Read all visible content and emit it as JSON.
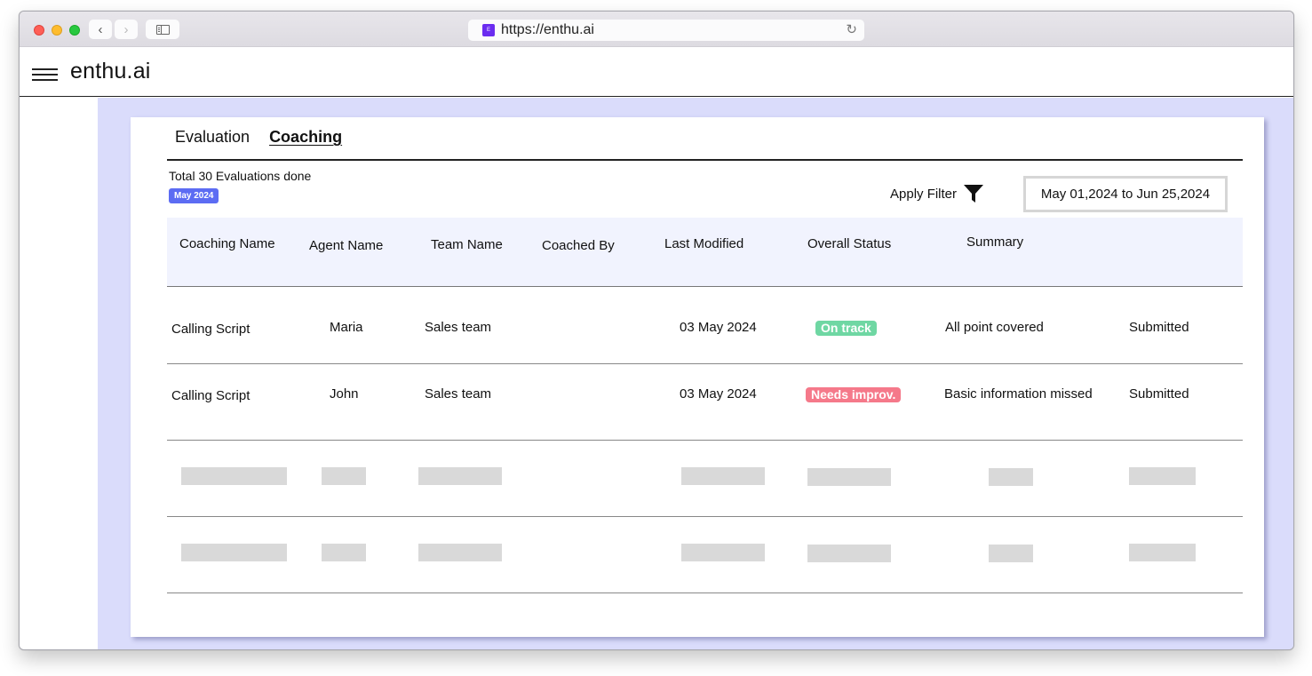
{
  "browser": {
    "url": "https://enthu.ai",
    "favicon_letter": "E",
    "back_icon": "chevron-left-icon",
    "forward_icon": "chevron-right-icon",
    "reload_icon": "reload-icon"
  },
  "app": {
    "brand": "enthu.ai",
    "menu_icon": "hamburger-icon"
  },
  "tabs": [
    {
      "label": "Evaluation",
      "active": false
    },
    {
      "label": "Coaching",
      "active": true
    }
  ],
  "overview": {
    "summary": "Total 30 Evaluations done",
    "month_badge": "May 2024",
    "badge_color": "#5c6cf3"
  },
  "filter": {
    "apply_label": "Apply Filter",
    "icon": "filter-funnel-icon",
    "date_range": "May 01,2024 to Jun 25,2024"
  },
  "table": {
    "columns": [
      "Coaching Name",
      "Agent Name",
      "Team Name",
      "Coached By",
      "Last Modified",
      "Overall Status",
      "Summary"
    ],
    "rows": [
      {
        "coaching_name": "Calling Script",
        "agent_name": "Maria",
        "team_name": "Sales team",
        "coached_by": "",
        "last_modified": "03 May 2024",
        "overall_status": "On track",
        "status_color": "#6fd7a3",
        "summary": "All point covered",
        "state": "Submitted"
      },
      {
        "coaching_name": "Calling Script",
        "agent_name": "John",
        "team_name": "Sales team",
        "coached_by": "",
        "last_modified": "03 May 2024",
        "overall_status": "Needs improv.",
        "status_color": "#f5798a",
        "summary": "Basic information missed",
        "state": "Submitted"
      }
    ],
    "placeholder_rows": 2
  }
}
